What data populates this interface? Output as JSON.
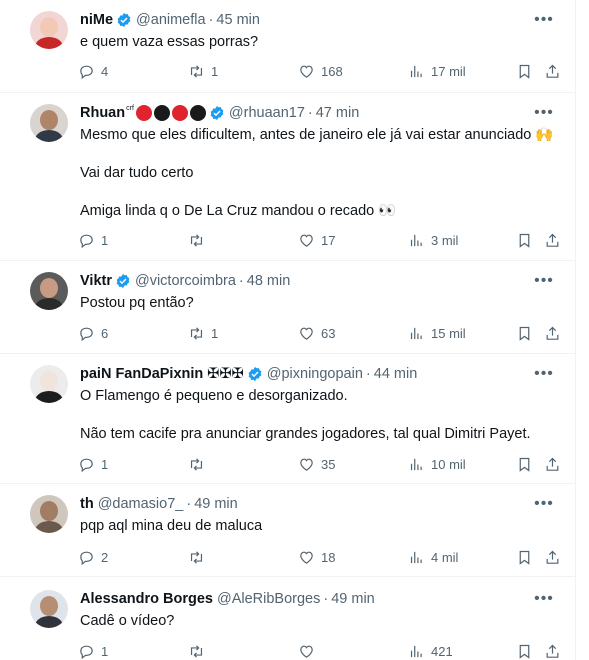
{
  "tweets": [
    {
      "name": "niMe",
      "name_suffix": "",
      "handle": "@animefla",
      "time": "45 min",
      "lines": [
        "e quem vaza essas porras?"
      ],
      "replies": "4",
      "retweets": "1",
      "likes": "168",
      "views": "17 mil",
      "avatar_colors": {
        "bg": "#f2d6d3",
        "head": "#f3c9b6",
        "body": "#c62828"
      }
    },
    {
      "name": "Rhuan",
      "name_suffix": "crf",
      "handle": "@rhuaan17",
      "time": "47 min",
      "lines": [
        "Mesmo que eles dificultem, antes de janeiro ele já vai estar anunciado 🙌",
        "",
        "Vai dar tudo certo",
        "",
        "Amiga linda q o De La Cruz mandou o recado 👀"
      ],
      "replies": "1",
      "retweets": "",
      "likes": "17",
      "views": "3 mil",
      "avatar_colors": {
        "bg": "#d9d4cf",
        "head": "#b08468",
        "body": "#2f3a46"
      }
    },
    {
      "name": "Viktr",
      "name_suffix": "",
      "handle": "@victorcoimbra",
      "time": "48 min",
      "lines": [
        "Postou pq então?"
      ],
      "replies": "6",
      "retweets": "1",
      "likes": "63",
      "views": "15 mil",
      "avatar_colors": {
        "bg": "#5b5b5b",
        "head": "#c79b83",
        "body": "#2b2b2b"
      }
    },
    {
      "name": "paiN FanDaPixnin ✠✠✠",
      "name_suffix": "",
      "handle": "@pixningopain",
      "time": "44 min",
      "lines": [
        "O Flamengo é pequeno e desorganizado.",
        "",
        "Não tem cacife pra anunciar grandes jogadores, tal qual Dimitri Payet."
      ],
      "replies": "1",
      "retweets": "",
      "likes": "35",
      "views": "10 mil",
      "avatar_colors": {
        "bg": "#ececec",
        "head": "#f1e4dc",
        "body": "#1d1d1d"
      }
    },
    {
      "name": "th",
      "name_suffix": "",
      "handle": "@damasio7_",
      "time": "49 min",
      "lines": [
        "pqp aql mina deu de maluca"
      ],
      "replies": "2",
      "retweets": "",
      "likes": "18",
      "views": "4 mil",
      "avatar_colors": {
        "bg": "#cfc7bd",
        "head": "#a27c63",
        "body": "#6b5a4c"
      }
    },
    {
      "name": "Alessandro Borges",
      "name_suffix": "",
      "handle": "@AleRibBorges",
      "time": "49 min",
      "lines": [
        "Cadê o vídeo?"
      ],
      "replies": "1",
      "retweets": "",
      "likes": "",
      "views": "421",
      "avatar_colors": {
        "bg": "#dfe4ea",
        "head": "#b58e74",
        "body": "#30343a"
      }
    }
  ],
  "rhuan_badges": [
    "#e0242f",
    "#1a1a1a",
    "#e0242f",
    "#1a1a1a"
  ],
  "separator": "·",
  "colors": {
    "text": "#0f1419",
    "muted": "#536471",
    "verified": "#1d9bf0",
    "border": "#eff3f4"
  }
}
